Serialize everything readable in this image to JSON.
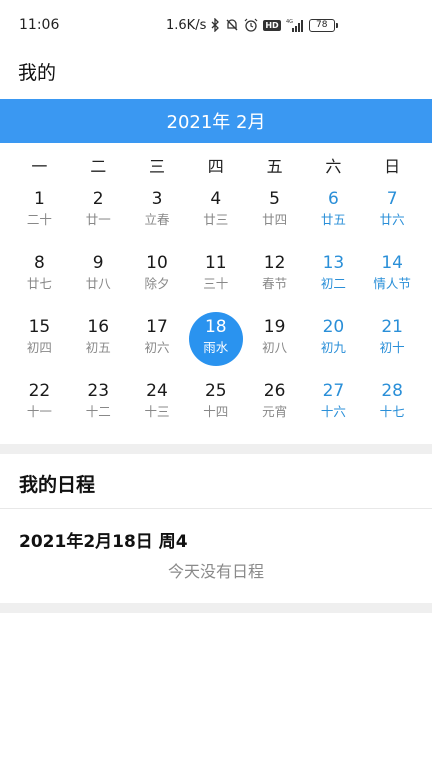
{
  "status_bar": {
    "time": "11:06",
    "net_speed": "1.6K/s",
    "network": "4G",
    "hd": "HD",
    "battery": "78"
  },
  "page_title": "我的",
  "calendar": {
    "month_label": "2021年 2月",
    "accent_color": "#3a98f2",
    "weekend_color": "#2a8fd8",
    "weekdays": [
      "一",
      "二",
      "三",
      "四",
      "五",
      "六",
      "日"
    ],
    "weeks": [
      [
        {
          "day": "1",
          "lunar": "二十"
        },
        {
          "day": "2",
          "lunar": "廿一"
        },
        {
          "day": "3",
          "lunar": "立春"
        },
        {
          "day": "4",
          "lunar": "廿三"
        },
        {
          "day": "5",
          "lunar": "廿四"
        },
        {
          "day": "6",
          "lunar": "廿五"
        },
        {
          "day": "7",
          "lunar": "廿六"
        }
      ],
      [
        {
          "day": "8",
          "lunar": "廿七"
        },
        {
          "day": "9",
          "lunar": "廿八"
        },
        {
          "day": "10",
          "lunar": "除夕"
        },
        {
          "day": "11",
          "lunar": "三十"
        },
        {
          "day": "12",
          "lunar": "春节"
        },
        {
          "day": "13",
          "lunar": "初二"
        },
        {
          "day": "14",
          "lunar": "情人节"
        }
      ],
      [
        {
          "day": "15",
          "lunar": "初四"
        },
        {
          "day": "16",
          "lunar": "初五"
        },
        {
          "day": "17",
          "lunar": "初六"
        },
        {
          "day": "18",
          "lunar": "雨水",
          "selected": true
        },
        {
          "day": "19",
          "lunar": "初八"
        },
        {
          "day": "20",
          "lunar": "初九"
        },
        {
          "day": "21",
          "lunar": "初十"
        }
      ],
      [
        {
          "day": "22",
          "lunar": "十一"
        },
        {
          "day": "23",
          "lunar": "十二"
        },
        {
          "day": "24",
          "lunar": "十三"
        },
        {
          "day": "25",
          "lunar": "十四"
        },
        {
          "day": "26",
          "lunar": "元宵"
        },
        {
          "day": "27",
          "lunar": "十六"
        },
        {
          "day": "28",
          "lunar": "十七"
        }
      ]
    ]
  },
  "schedule": {
    "title": "我的日程",
    "date": "2021年2月18日 周4",
    "empty_text": "今天没有日程"
  }
}
